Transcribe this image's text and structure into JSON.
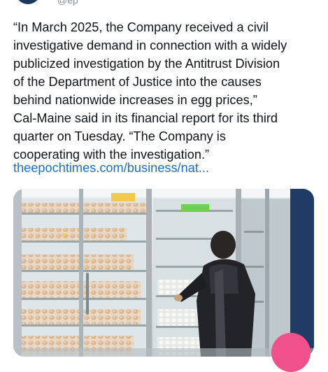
{
  "author": {
    "handle": "@ep"
  },
  "tweet": {
    "lines": [
      "“In March 2025, the Company received a civil",
      "investigative demand in connection with a widely",
      "publicized investigation by the Antitrust Division",
      "of the Department of Justice into the causes",
      "behind nationwide increases in egg prices,”",
      "Cal-Maine said in its financial report for its third",
      "quarter on Tuesday. “The Company is",
      "cooperating with the investigation.”"
    ],
    "link_text": "theepochtimes.com/business/nat..."
  },
  "media": {
    "alt": "Shopper opening a refrigerated egg case in a grocery store"
  },
  "colors": {
    "text": "#0f1419",
    "link": "#1b6fc9",
    "fab": "#f0518a"
  }
}
